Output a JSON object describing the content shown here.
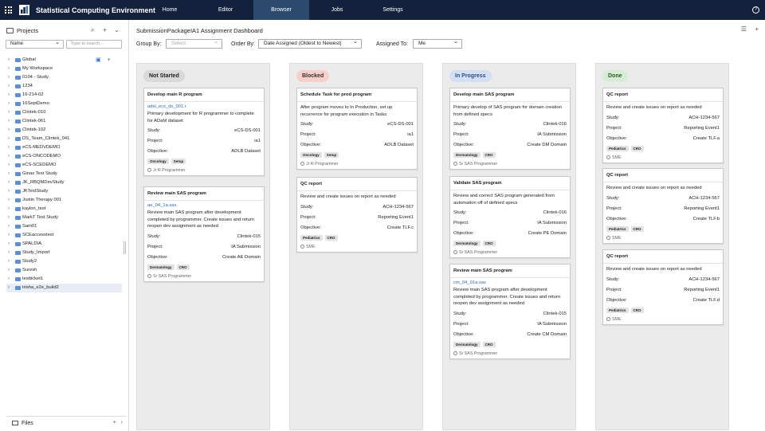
{
  "app": {
    "title": "Statistical Computing Environment",
    "nav": [
      "Home",
      "Editor",
      "Browser",
      "Jobs",
      "Settings"
    ],
    "active_nav": "Browser",
    "help": "?"
  },
  "left_panel": {
    "title": "Projects",
    "sort_select": "Name",
    "search_placeholder": "Type to search...",
    "tree": [
      "Global",
      "My Workspace",
      "0104 - Study",
      "1234",
      "16-214-02",
      "16SeptDemo",
      "Clintek-010",
      "Clintek-061",
      "Clintek-102",
      "DS_Team_Clintek_041",
      "eCS-MEDVDEMO",
      "eCS-ONCODEMO",
      "eCS-SCEDEMO",
      "Ginas Test Study",
      "JK_RBQMDevStudy",
      "JKTestStudy",
      "Justin Therapy 001",
      "kaylon_test",
      "MarkT Test Study",
      "Sam01",
      "SCEaccesstest",
      "SPALDIA",
      "Study_Import",
      "Study2",
      "Suresh",
      "testticket1",
      "trisha_e2e_build2"
    ],
    "files_label": "Files"
  },
  "main": {
    "title": "SubmissionPackageIA1 Assignment Dashboard",
    "group_by_label": "Group By:",
    "group_by_placeholder": "Select",
    "order_by_label": "Order By:",
    "order_by_value": "Date Assigned (Oldest to Newest)",
    "assigned_to_label": "Assigned To:",
    "assigned_to_value": "Me"
  },
  "labels": {
    "study": "Study:",
    "project": "Project:",
    "objective": "Objective:"
  },
  "columns": [
    {
      "name": "Not Started",
      "badge_bg": "#d9d9d9",
      "badge_fg": "#222",
      "cards": [
        {
          "title": "Develop main R program",
          "link": "adsl_ecs_ds_001.r",
          "desc": "Primary development for R programmer to complete for ADaM dataset",
          "study": "eCS-DS-001",
          "project": "ia1",
          "objective": "ADLB Dataset",
          "tags": [
            "Oncology",
            "Setup"
          ],
          "assignee": "Jr R Programmer"
        },
        {
          "title": "Review main SAS program",
          "link": "ae_04_1a.sas",
          "desc": "Review main SAS program after development completed by programmer. Create issues and return reopen dev assignment as needed",
          "study": "Clintek-015",
          "project": "IA Submission",
          "objective": "Create AE Domain",
          "tags": [
            "Dermatology",
            "CRO"
          ],
          "assignee": "Sr SAS Programmer"
        }
      ]
    },
    {
      "name": "Blocked",
      "badge_bg": "#f8cfc9",
      "badge_fg": "#333",
      "cards": [
        {
          "title": "Schedule Task for prod program",
          "link": "",
          "desc": "After program moves to In Production, set up recurrence for program execution in Tasks",
          "study": "eCS-DS-001",
          "project": "ia1",
          "objective": "ADLB Dataset",
          "tags": [
            "Oncology",
            "Setup"
          ],
          "assignee": "Jr R Programmer"
        },
        {
          "title": "QC report",
          "link": "",
          "desc": "Review and create issues on report as needed",
          "study": "ACH-1234-567",
          "project": "Reporting Event1",
          "objective": "Create TLF.c",
          "tags": [
            "Pediatrics",
            "CRO"
          ],
          "assignee": "SME"
        }
      ]
    },
    {
      "name": "In Progress",
      "badge_bg": "#d3e0f3",
      "badge_fg": "#2b4f87",
      "cards": [
        {
          "title": "Develop main SAS program",
          "link": "",
          "desc": "Primary develop of SAS program for domain creation from defined specs",
          "study": "Clintek-016",
          "project": "IA Submission",
          "objective": "Create DM Domain",
          "tags": [
            "Dermatology",
            "CRO"
          ],
          "assignee": "Sr SAS Programmer"
        },
        {
          "title": "Validate SAS program",
          "link": "",
          "desc": "Review and correct SAS program generated from automation off of defined specs",
          "study": "Clintek-016",
          "project": "IA Submission",
          "objective": "Create PE Domain",
          "tags": [
            "Dermatology",
            "CRO"
          ],
          "assignee": "Sr SAS Programmer"
        },
        {
          "title": "Review main SAS program",
          "link": "cm_04_01a.sas",
          "desc": "Review main SAS program after development completed by programmer. Create issues and return reopen dev assignment as needed",
          "study": "Clintek-015",
          "project": "IA Submission",
          "objective": "Create CM Domain",
          "tags": [
            "Dermatology",
            "CRO"
          ],
          "assignee": "Sr SAS Programmer"
        }
      ]
    },
    {
      "name": "Done",
      "badge_bg": "#d7ecd4",
      "badge_fg": "#2d5a27",
      "cards": [
        {
          "title": "QC report",
          "link": "",
          "desc": "Review and create issues on report as needed",
          "study": "ACH-1234-567",
          "project": "Reporting Event1",
          "objective": "Create TLF.a",
          "tags": [
            "Pediatrics",
            "CRO"
          ],
          "assignee": "SME"
        },
        {
          "title": "QC report",
          "link": "",
          "desc": "Review and create issues on report as needed",
          "study": "ACH-1234-567",
          "project": "Reporting Event1",
          "objective": "Create TLF.b",
          "tags": [
            "Pediatrics",
            "CRO"
          ],
          "assignee": "SME"
        },
        {
          "title": "QC report",
          "link": "",
          "desc": "Review and create issues on report as needed",
          "study": "ACH-1234-567",
          "project": "Reporting Event1",
          "objective": "Create TLF.d",
          "tags": [
            "Pediatrics",
            "CRO"
          ],
          "assignee": "SME"
        }
      ]
    }
  ]
}
